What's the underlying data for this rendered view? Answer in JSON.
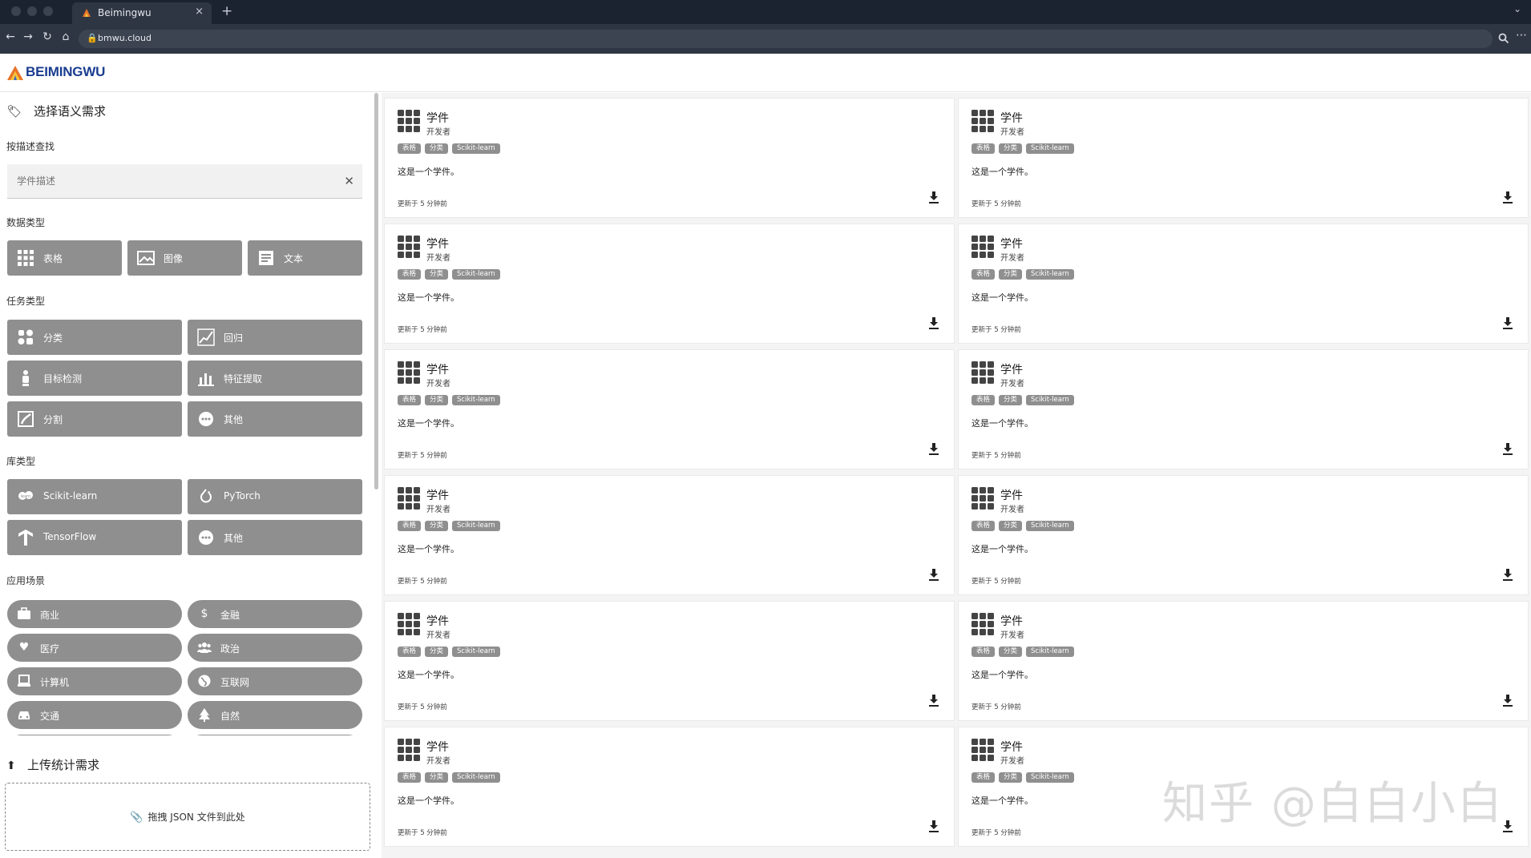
{
  "browser": {
    "tab_title": "Beimingwu",
    "tab_close": "×",
    "new_tab": "+",
    "tab_menu": "⌄",
    "url": "bmwu.cloud",
    "more_icon": "⋯"
  },
  "site": {
    "brand": "BEIMINGWU"
  },
  "sidebar": {
    "semantic_title": "选择语义需求",
    "search": {
      "label": "按描述查找",
      "placeholder": "学件描述"
    },
    "data_type": {
      "label": "数据类型",
      "items": [
        {
          "label": "表格",
          "icon": "table-icon"
        },
        {
          "label": "图像",
          "icon": "image-icon"
        },
        {
          "label": "文本",
          "icon": "text-icon"
        }
      ]
    },
    "task_type": {
      "label": "任务类型",
      "items": [
        {
          "label": "分类",
          "icon": "classification-icon"
        },
        {
          "label": "回归",
          "icon": "regression-icon"
        },
        {
          "label": "目标检测",
          "icon": "detection-icon"
        },
        {
          "label": "特征提取",
          "icon": "feature-extraction-icon"
        },
        {
          "label": "分割",
          "icon": "segmentation-icon"
        },
        {
          "label": "其他",
          "icon": "other-icon"
        }
      ]
    },
    "library_type": {
      "label": "库类型",
      "items": [
        {
          "label": "Scikit-learn",
          "icon": "scikit-learn-icon"
        },
        {
          "label": "PyTorch",
          "icon": "pytorch-icon"
        },
        {
          "label": "TensorFlow",
          "icon": "tensorflow-icon"
        },
        {
          "label": "其他",
          "icon": "other-icon"
        }
      ]
    },
    "scenario": {
      "label": "应用场景",
      "items": [
        {
          "label": "商业",
          "icon": "briefcase-icon"
        },
        {
          "label": "金融",
          "icon": "dollar-icon"
        },
        {
          "label": "医疗",
          "icon": "heart-icon"
        },
        {
          "label": "政治",
          "icon": "people-icon"
        },
        {
          "label": "计算机",
          "icon": "computer-icon"
        },
        {
          "label": "互联网",
          "icon": "globe-icon"
        },
        {
          "label": "交通",
          "icon": "car-icon"
        },
        {
          "label": "自然",
          "icon": "tree-icon"
        }
      ]
    },
    "upload": {
      "title": "上传统计需求",
      "drop_text": "拖拽 JSON 文件到此处"
    }
  },
  "cards": [
    {
      "name": "学件",
      "developer": "开发者",
      "tags": [
        "表格",
        "分类",
        "Scikit-learn"
      ],
      "description": "这是一个学件。",
      "updated": "更新于 5 分钟前"
    },
    {
      "name": "学件",
      "developer": "开发者",
      "tags": [
        "表格",
        "分类",
        "Scikit-learn"
      ],
      "description": "这是一个学件。",
      "updated": "更新于 5 分钟前"
    },
    {
      "name": "学件",
      "developer": "开发者",
      "tags": [
        "表格",
        "分类",
        "Scikit-learn"
      ],
      "description": "这是一个学件。",
      "updated": "更新于 5 分钟前"
    },
    {
      "name": "学件",
      "developer": "开发者",
      "tags": [
        "表格",
        "分类",
        "Scikit-learn"
      ],
      "description": "这是一个学件。",
      "updated": "更新于 5 分钟前"
    },
    {
      "name": "学件",
      "developer": "开发者",
      "tags": [
        "表格",
        "分类",
        "Scikit-learn"
      ],
      "description": "这是一个学件。",
      "updated": "更新于 5 分钟前"
    },
    {
      "name": "学件",
      "developer": "开发者",
      "tags": [
        "表格",
        "分类",
        "Scikit-learn"
      ],
      "description": "这是一个学件。",
      "updated": "更新于 5 分钟前"
    },
    {
      "name": "学件",
      "developer": "开发者",
      "tags": [
        "表格",
        "分类",
        "Scikit-learn"
      ],
      "description": "这是一个学件。",
      "updated": "更新于 5 分钟前"
    },
    {
      "name": "学件",
      "developer": "开发者",
      "tags": [
        "表格",
        "分类",
        "Scikit-learn"
      ],
      "description": "这是一个学件。",
      "updated": "更新于 5 分钟前"
    },
    {
      "name": "学件",
      "developer": "开发者",
      "tags": [
        "表格",
        "分类",
        "Scikit-learn"
      ],
      "description": "这是一个学件。",
      "updated": "更新于 5 分钟前"
    },
    {
      "name": "学件",
      "developer": "开发者",
      "tags": [
        "表格",
        "分类",
        "Scikit-learn"
      ],
      "description": "这是一个学件。",
      "updated": "更新于 5 分钟前"
    },
    {
      "name": "学件",
      "developer": "开发者",
      "tags": [
        "表格",
        "分类",
        "Scikit-learn"
      ],
      "description": "这是一个学件。",
      "updated": "更新于 5 分钟前"
    },
    {
      "name": "学件",
      "developer": "开发者",
      "tags": [
        "表格",
        "分类",
        "Scikit-learn"
      ],
      "description": "这是一个学件。",
      "updated": "更新于 5 分钟前"
    }
  ],
  "watermark": "知乎 @白白小白"
}
